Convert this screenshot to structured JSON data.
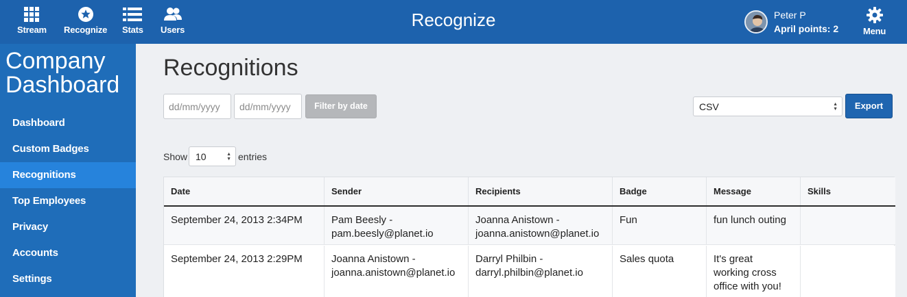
{
  "topbar": {
    "nav": [
      {
        "label": "Stream",
        "icon": "grid-icon"
      },
      {
        "label": "Recognize",
        "icon": "star-badge-icon"
      },
      {
        "label": "Stats",
        "icon": "list-icon"
      },
      {
        "label": "Users",
        "icon": "users-icon"
      }
    ],
    "title": "Recognize",
    "user_name": "Peter P",
    "user_points": "April points: 2",
    "menu_label": "Menu",
    "menu_icon": "gear-icon"
  },
  "sidebar": {
    "title": "Company Dashboard",
    "items": [
      {
        "label": "Dashboard"
      },
      {
        "label": "Custom Badges"
      },
      {
        "label": "Recognitions",
        "active": true
      },
      {
        "label": "Top Employees"
      },
      {
        "label": "Privacy"
      },
      {
        "label": "Accounts"
      },
      {
        "label": "Settings"
      }
    ]
  },
  "main": {
    "title": "Recognitions",
    "date_from_placeholder": "dd/mm/yyyy",
    "date_to_placeholder": "dd/mm/yyyy",
    "filter_label": "Filter by date",
    "format_value": "CSV",
    "export_label": "Export",
    "show_label": "Show",
    "entries_value": "10",
    "entries_label": "entries"
  },
  "table": {
    "columns": [
      "Date",
      "Sender",
      "Recipients",
      "Badge",
      "Message",
      "Skills"
    ],
    "rows": [
      {
        "date": "September 24, 2013 2:34PM",
        "sender": [
          "Pam Beesly -",
          "pam.beesly@planet.io"
        ],
        "recipients": [
          "Joanna Anistown -",
          "joanna.anistown@planet.io"
        ],
        "badge": "Fun",
        "message": [
          "fun lunch outing"
        ],
        "skills": ""
      },
      {
        "date": "September 24, 2013 2:29PM",
        "sender": [
          "Joanna Anistown -",
          "joanna.anistown@planet.io"
        ],
        "recipients": [
          "Darryl Philbin -",
          "darryl.philbin@planet.io"
        ],
        "badge": "Sales quota",
        "message": [
          "It's great",
          "working cross",
          "office with you!"
        ],
        "skills": ""
      }
    ]
  },
  "colors": {
    "topbar": "#1d62ad",
    "sidebar": "#1f6db9",
    "sidebar_active": "#2683dc",
    "export_button": "#1f65b0",
    "page_background": "#eef0f3"
  }
}
